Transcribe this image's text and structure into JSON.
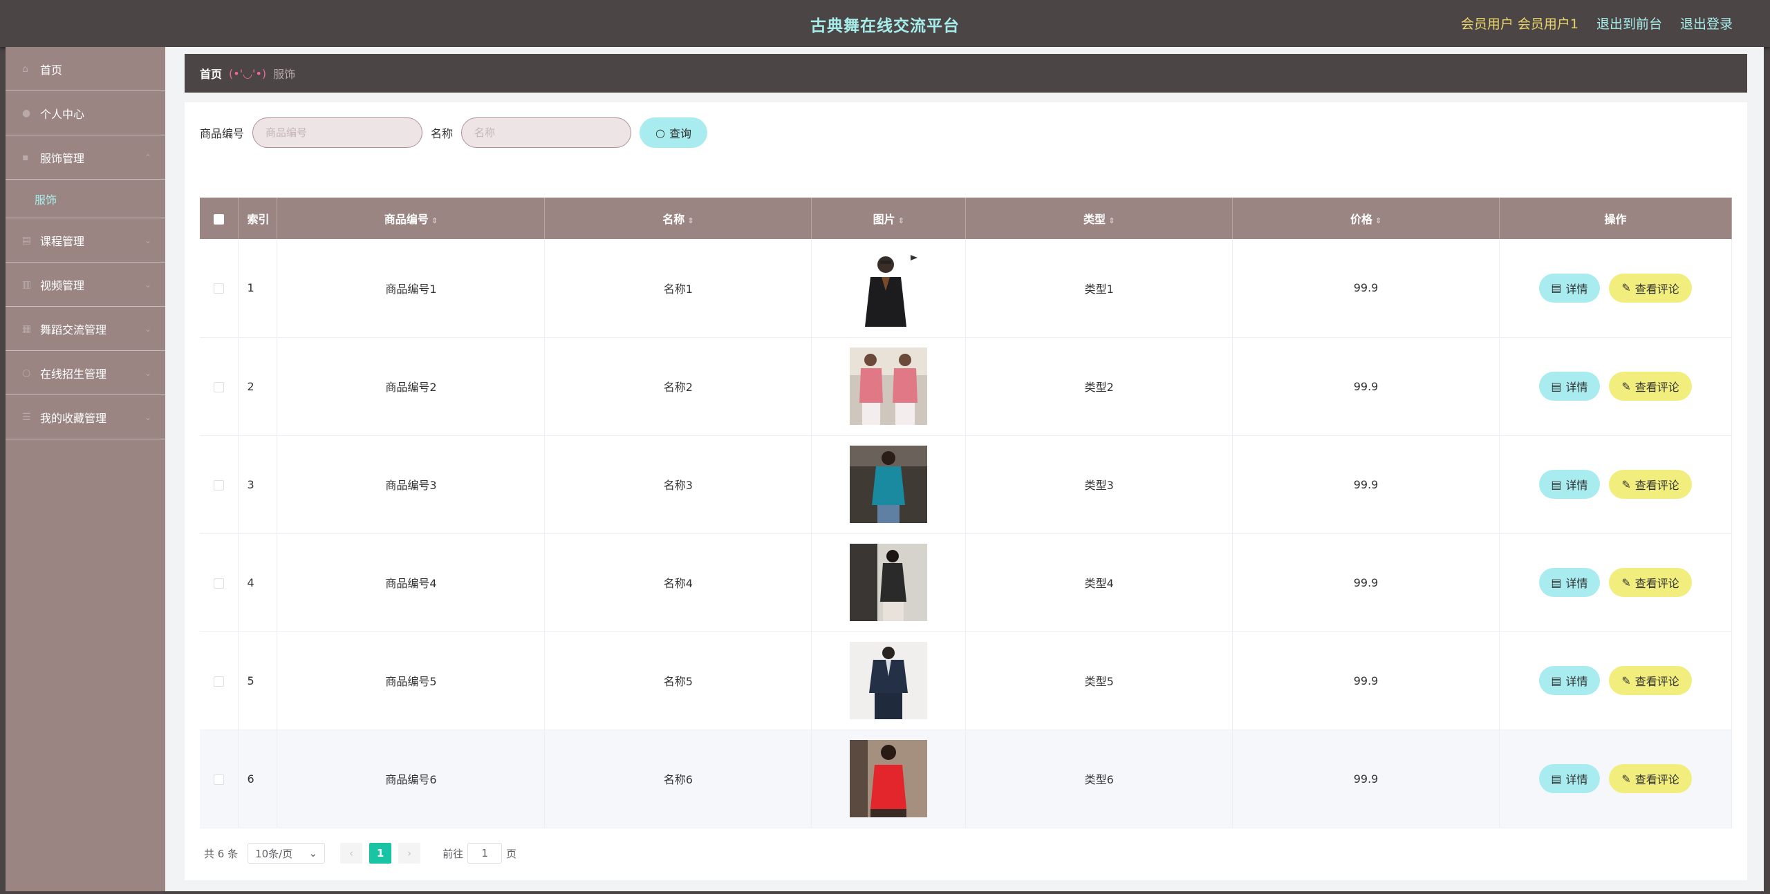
{
  "header": {
    "title": "古典舞在线交流平台",
    "user_label": "会员用户 会员用户1",
    "front_link": "退出到前台",
    "logout_link": "退出登录"
  },
  "sidebar": {
    "items": [
      {
        "label": "首页",
        "icon": "home-icon"
      },
      {
        "label": "个人中心",
        "icon": "user-icon"
      },
      {
        "label": "服饰管理",
        "icon": "clothing-icon"
      },
      {
        "label": "服饰",
        "icon": ""
      },
      {
        "label": "课程管理",
        "icon": "course-icon"
      },
      {
        "label": "视频管理",
        "icon": "video-icon"
      },
      {
        "label": "舞蹈交流管理",
        "icon": "chat-icon"
      },
      {
        "label": "在线招生管理",
        "icon": "enroll-icon"
      },
      {
        "label": "我的收藏管理",
        "icon": "collect-icon"
      }
    ]
  },
  "breadcrumb": {
    "home": "首页",
    "separator": "(•'◡'•)",
    "current": "服饰"
  },
  "search": {
    "code_label": "商品编号",
    "code_placeholder": "商品编号",
    "name_label": "名称",
    "name_placeholder": "名称",
    "query_button": "查询"
  },
  "table": {
    "headers": {
      "index": "索引",
      "code": "商品编号",
      "name": "名称",
      "image": "图片",
      "type": "类型",
      "price": "价格",
      "action": "操作"
    },
    "rows": [
      {
        "index": "1",
        "code": "商品编号1",
        "name": "名称1",
        "type": "类型1",
        "price": "99.9"
      },
      {
        "index": "2",
        "code": "商品编号2",
        "name": "名称2",
        "type": "类型2",
        "price": "99.9"
      },
      {
        "index": "3",
        "code": "商品编号3",
        "name": "名称3",
        "type": "类型3",
        "price": "99.9"
      },
      {
        "index": "4",
        "code": "商品编号4",
        "name": "名称4",
        "type": "类型4",
        "price": "99.9"
      },
      {
        "index": "5",
        "code": "商品编号5",
        "name": "名称5",
        "type": "类型5",
        "price": "99.9"
      },
      {
        "index": "6",
        "code": "商品编号6",
        "name": "名称6",
        "type": "类型6",
        "price": "99.9"
      }
    ],
    "detail_button": "详情",
    "comment_button": "查看评论"
  },
  "pager": {
    "total": "共 6 条",
    "page_size": "10条/页",
    "current_page": "1",
    "goto_label": "前往",
    "goto_value": "1",
    "page_unit": "页"
  },
  "colors": {
    "title": "#a6ecea",
    "sidebar": "#9a8583",
    "header": "#4b4545",
    "accent_cyan": "#a8ecef",
    "accent_yellow": "#f1ee7e",
    "page_active": "#19c4a5"
  }
}
